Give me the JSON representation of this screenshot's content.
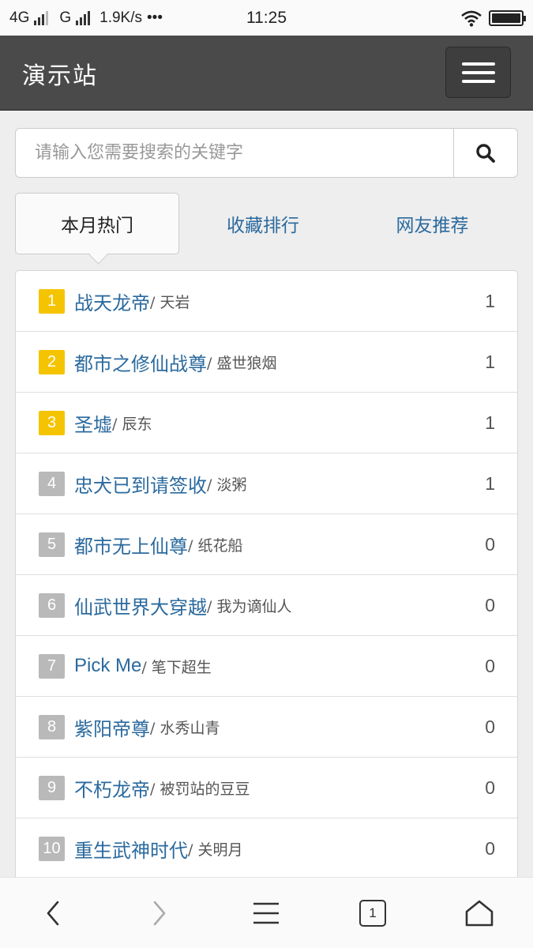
{
  "status_bar": {
    "network_1": "4G",
    "network_2": "G",
    "speed": "1.9K/s",
    "more": "•••",
    "time": "11:25",
    "icons": [
      "signal-icon",
      "wifi-icon",
      "battery-icon"
    ]
  },
  "header": {
    "brand": "演示站",
    "menu_icon": "hamburger-icon"
  },
  "search": {
    "placeholder": "请输入您需要搜索的关键字",
    "icon": "search-icon"
  },
  "tabs": [
    {
      "label": "本月热门",
      "active": true
    },
    {
      "label": "收藏排行",
      "active": false
    },
    {
      "label": "网友推荐",
      "active": false
    }
  ],
  "ranking": [
    {
      "rank": "1",
      "title": "战天龙帝",
      "author": "/ 天岩",
      "count": "1",
      "highlight": true
    },
    {
      "rank": "2",
      "title": "都市之修仙战尊",
      "author": "/ 盛世狼烟",
      "count": "1",
      "highlight": true
    },
    {
      "rank": "3",
      "title": "圣墟",
      "author": "/ 辰东",
      "count": "1",
      "highlight": true
    },
    {
      "rank": "4",
      "title": "忠犬已到请签收",
      "author": "/ 淡粥",
      "count": "1",
      "highlight": false
    },
    {
      "rank": "5",
      "title": "都市无上仙尊",
      "author": "/ 纸花船",
      "count": "0",
      "highlight": false
    },
    {
      "rank": "6",
      "title": "仙武世界大穿越",
      "author": "/ 我为谪仙人",
      "count": "0",
      "highlight": false
    },
    {
      "rank": "7",
      "title": "Pick Me",
      "author": "/ 笔下超生",
      "count": "0",
      "highlight": false
    },
    {
      "rank": "8",
      "title": "紫阳帝尊",
      "author": "/ 水秀山青",
      "count": "0",
      "highlight": false
    },
    {
      "rank": "9",
      "title": "不朽龙帝",
      "author": "/ 被罚站的豆豆",
      "count": "0",
      "highlight": false
    },
    {
      "rank": "10",
      "title": "重生武神时代",
      "author": "/ 关明月",
      "count": "0",
      "highlight": false
    }
  ],
  "bottom_nav": {
    "tab_count": "1",
    "icons": [
      "back-icon",
      "forward-icon",
      "menu-icon",
      "tabs-icon",
      "home-icon"
    ]
  },
  "colors": {
    "header_bg": "#4a4a4a",
    "link": "#2b6a9e",
    "rank_top": "#f5c400",
    "rank_normal": "#b9b9b9"
  }
}
